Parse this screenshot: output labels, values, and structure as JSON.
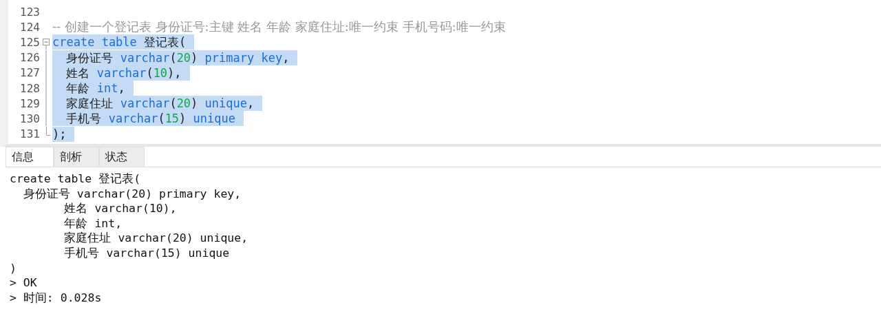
{
  "editor": {
    "lines": [
      {
        "number": "123",
        "kind": "plain"
      },
      {
        "number": "124",
        "kind": "plain",
        "tokens": [
          {
            "kind": "comment",
            "text": "-- 创建一个登记表 身份证号:主键 姓名 年龄 家庭住址:唯一约束 手机号码:唯一约束"
          }
        ],
        "selected": false
      },
      {
        "number": "125",
        "kind": "fold-start",
        "tokens": [
          {
            "kind": "keyword",
            "text": "create table"
          },
          {
            "kind": "plain",
            "text": " 登记表("
          }
        ],
        "selected": true
      },
      {
        "number": "126",
        "kind": "fold-body",
        "tokens": [
          {
            "kind": "plain",
            "text": "  身份证号 "
          },
          {
            "kind": "keyword",
            "text": "varchar"
          },
          {
            "kind": "plain",
            "text": "("
          },
          {
            "kind": "number",
            "text": "20"
          },
          {
            "kind": "plain",
            "text": ") "
          },
          {
            "kind": "keyword",
            "text": "primary key"
          },
          {
            "kind": "plain",
            "text": ","
          }
        ],
        "selected": true
      },
      {
        "number": "127",
        "kind": "fold-body",
        "tokens": [
          {
            "kind": "plain",
            "text": "  姓名 "
          },
          {
            "kind": "keyword",
            "text": "varchar"
          },
          {
            "kind": "plain",
            "text": "("
          },
          {
            "kind": "number",
            "text": "10"
          },
          {
            "kind": "plain",
            "text": "),"
          }
        ],
        "selected": true
      },
      {
        "number": "128",
        "kind": "fold-body",
        "tokens": [
          {
            "kind": "plain",
            "text": "  年龄 "
          },
          {
            "kind": "keyword",
            "text": "int"
          },
          {
            "kind": "plain",
            "text": ","
          }
        ],
        "selected": true
      },
      {
        "number": "129",
        "kind": "fold-body",
        "tokens": [
          {
            "kind": "plain",
            "text": "  家庭住址 "
          },
          {
            "kind": "keyword",
            "text": "varchar"
          },
          {
            "kind": "plain",
            "text": "("
          },
          {
            "kind": "number",
            "text": "20"
          },
          {
            "kind": "plain",
            "text": ") "
          },
          {
            "kind": "keyword",
            "text": "unique"
          },
          {
            "kind": "plain",
            "text": ","
          }
        ],
        "selected": true
      },
      {
        "number": "130",
        "kind": "fold-body",
        "tokens": [
          {
            "kind": "plain",
            "text": "  手机号 "
          },
          {
            "kind": "keyword",
            "text": "varchar"
          },
          {
            "kind": "plain",
            "text": "("
          },
          {
            "kind": "number",
            "text": "15"
          },
          {
            "kind": "plain",
            "text": ") "
          },
          {
            "kind": "keyword",
            "text": "unique"
          }
        ],
        "selected": true
      },
      {
        "number": "131",
        "kind": "fold-end",
        "tokens": [
          {
            "kind": "plain",
            "text": ");"
          }
        ],
        "selected": true
      }
    ]
  },
  "tabs": [
    {
      "label": "信息",
      "selected": true
    },
    {
      "label": "剖析",
      "selected": false
    },
    {
      "label": "状态",
      "selected": false
    }
  ],
  "output": [
    "create table 登记表(",
    "  身份证号 varchar(20) primary key,",
    "        姓名 varchar(10),",
    "        年龄 int,",
    "        家庭住址 varchar(20) unique,",
    "        手机号 varchar(15) unique",
    ")",
    "> OK",
    "> 时间: 0.028s"
  ]
}
